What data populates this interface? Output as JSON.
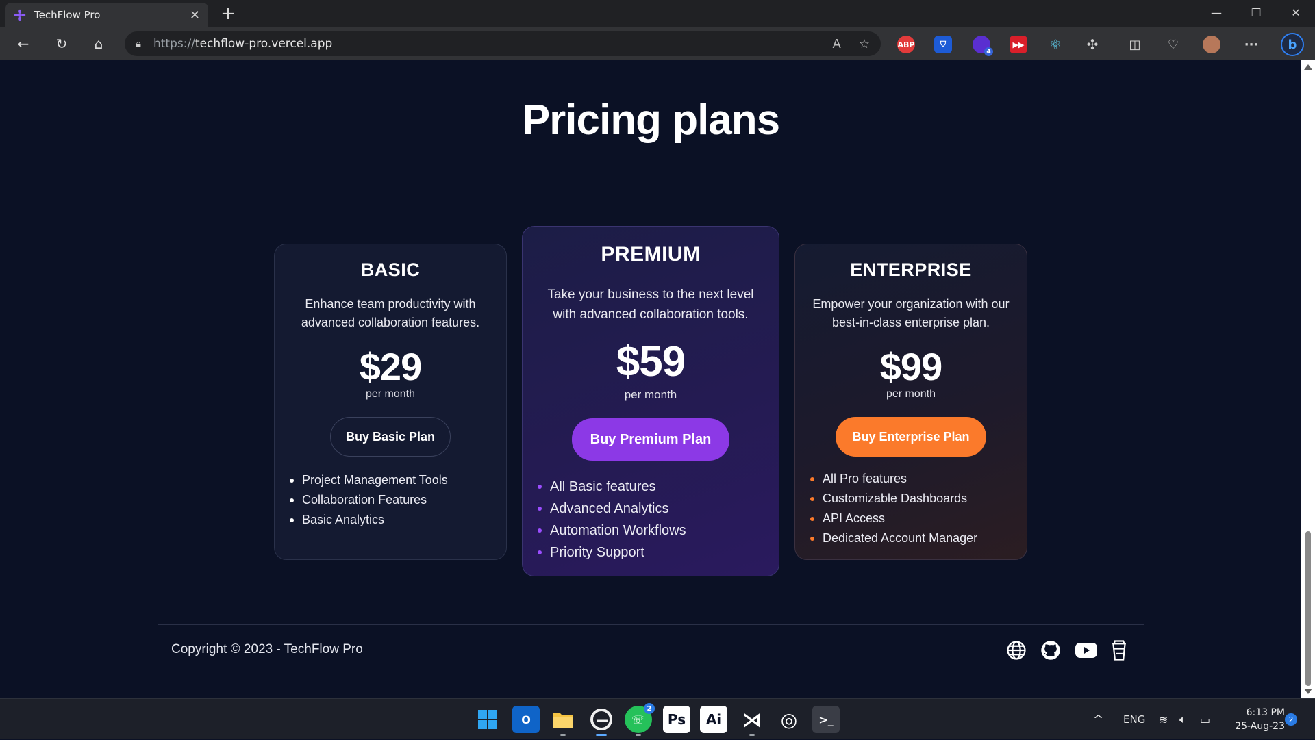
{
  "browser": {
    "tab_title": "TechFlow Pro",
    "tab_close": "✕",
    "new_tab": "+",
    "url_scheme": "https://",
    "url_host": "techflow-pro.vercel.app",
    "extensions": [
      "ABP",
      "shield",
      "4",
      "YT",
      "atom",
      "puzzle"
    ],
    "ext_badge": "4"
  },
  "page": {
    "heading": "Pricing plans",
    "plans": [
      {
        "name": "BASIC",
        "description": "Enhance team productivity with advanced collaboration features.",
        "price": "$29",
        "period": "per month",
        "button": "Buy Basic Plan",
        "features": [
          "Project Management Tools",
          "Collaboration Features",
          "Basic Analytics"
        ]
      },
      {
        "name": "PREMIUM",
        "description": "Take your business to the next level with advanced collaboration tools.",
        "price": "$59",
        "period": "per month",
        "button": "Buy Premium Plan",
        "features": [
          "All Basic features",
          "Advanced Analytics",
          "Automation Workflows",
          "Priority Support"
        ]
      },
      {
        "name": "ENTERPRISE",
        "description": "Empower your organization with our best-in-class enterprise plan.",
        "price": "$99",
        "period": "per month",
        "button": "Buy Enterprise Plan",
        "features": [
          "All Pro features",
          "Customizable Dashboards",
          "API Access",
          "Dedicated Account Manager"
        ]
      }
    ],
    "footer": {
      "copyright": "Copyright © 2023 - TechFlow Pro",
      "social_icons": [
        "globe-icon",
        "github-icon",
        "youtube-icon",
        "coffee-cup-icon"
      ]
    },
    "colors": {
      "background": "#0b1125",
      "premium_accent": "#8c39e6",
      "enterprise_accent": "#fb7a2b"
    }
  },
  "taskbar": {
    "apps": [
      "start",
      "outlook",
      "file-explorer",
      "edge",
      "whatsapp",
      "photoshop",
      "illustrator",
      "vscode",
      "obs",
      "terminal"
    ],
    "whatsapp_badge": "2",
    "ps_label": "Ps",
    "ai_label": "Ai",
    "language": "ENG",
    "time": "6:13 PM",
    "date": "25-Aug-23",
    "notification_count": "2"
  }
}
